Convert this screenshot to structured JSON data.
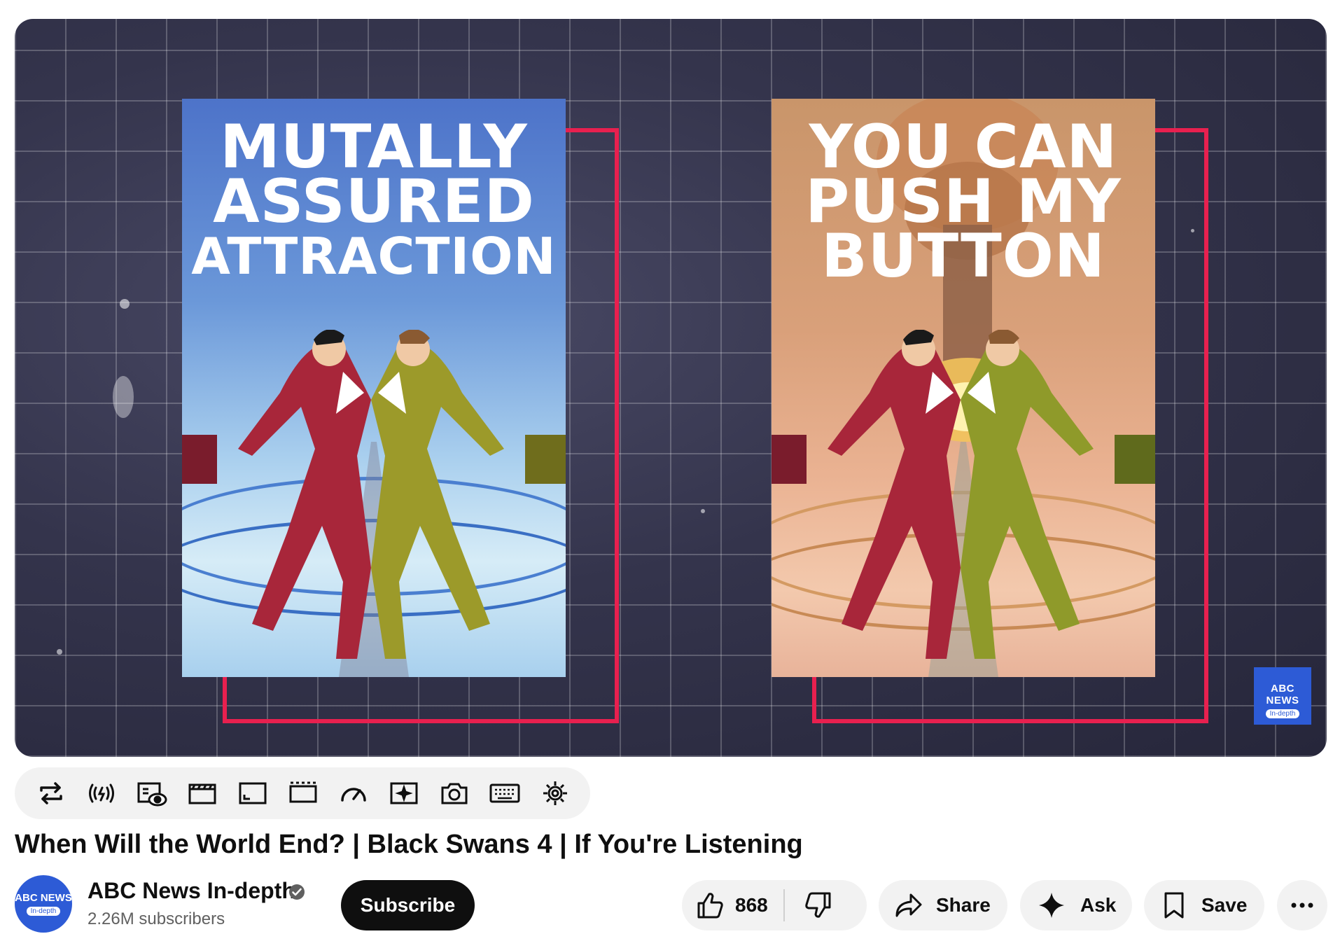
{
  "video": {
    "poster_left_title": [
      "MUTALLY",
      "ASSURED",
      "ATTRACTION"
    ],
    "poster_right_title": [
      "YOU CAN",
      "PUSH MY",
      "BUTTON"
    ],
    "watermark": {
      "line1": "ABC NEWS",
      "line2": "In-depth"
    }
  },
  "toolbar": {
    "icons": [
      "loop-icon",
      "live-broadcast-icon",
      "watch-later-icon",
      "clapperboard-icon",
      "picture-in-picture-icon",
      "theater-mode-icon",
      "speed-gauge-icon",
      "sparkle-card-icon",
      "screenshot-camera-icon",
      "keyboard-icon",
      "settings-gear-icon"
    ]
  },
  "title": "When Will the World End? | Black Swans 4 | If You're Listening",
  "channel": {
    "name": "ABC News In-depth",
    "subscribers": "2.26M subscribers",
    "avatar_line1": "ABC NEWS",
    "avatar_line2": "In-depth",
    "subscribe_label": "Subscribe"
  },
  "actions": {
    "like_count": "868",
    "share_label": "Share",
    "ask_label": "Ask",
    "save_label": "Save"
  },
  "colors": {
    "accent_red": "#e8204f",
    "abc_blue": "#2d5bd6",
    "button_black": "#0f0f0f",
    "pill_gray": "#f2f2f2"
  }
}
